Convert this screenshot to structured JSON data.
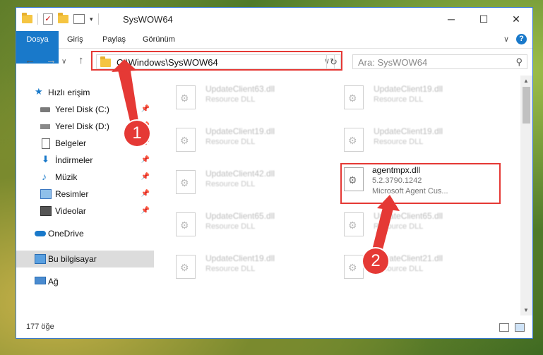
{
  "window": {
    "title": "SysWOW64",
    "minimize": "─",
    "maximize": "☐",
    "close": "✕"
  },
  "ribbon": {
    "tabs": [
      "Dosya",
      "Giriş",
      "Paylaş",
      "Görünüm"
    ],
    "help": "?",
    "expand": "∨"
  },
  "nav": {
    "back": "←",
    "forward": "→",
    "up": "↑",
    "address": "C:\\Windows\\SysWOW64",
    "dropdown": "∨",
    "refresh": "↻",
    "search_placeholder": "Ara: SysWOW64",
    "search_icon": "⚲"
  },
  "sidebar": {
    "items": [
      {
        "label": "Hızlı erişim",
        "icon": "star-icon",
        "pinned": false
      },
      {
        "label": "Yerel Disk (C:)",
        "icon": "disk-icon",
        "pinned": true
      },
      {
        "label": "Yerel Disk (D:)",
        "icon": "disk-icon",
        "pinned": true
      },
      {
        "label": "Belgeler",
        "icon": "document-icon",
        "pinned": true
      },
      {
        "label": "İndirmeler",
        "icon": "download-icon",
        "pinned": true
      },
      {
        "label": "Müzik",
        "icon": "music-icon",
        "pinned": true
      },
      {
        "label": "Resimler",
        "icon": "pictures-icon",
        "pinned": true
      },
      {
        "label": "Videolar",
        "icon": "video-icon",
        "pinned": true
      },
      {
        "label": "OneDrive",
        "icon": "cloud-icon",
        "pinned": false
      },
      {
        "label": "Bu bilgisayar",
        "icon": "pc-icon",
        "pinned": false,
        "selected": true
      },
      {
        "label": "Ağ",
        "icon": "network-icon",
        "pinned": false
      }
    ],
    "pin_glyph": "📌"
  },
  "files": [
    {
      "name": "UpdateClient63.dll",
      "desc": "Resource DLL",
      "blurred": true
    },
    {
      "name": "UpdateClient19.dll",
      "desc": "Resource DLL",
      "blurred": true
    },
    {
      "name": "UpdateClient19.dll",
      "desc": "Resource DLL",
      "blurred": true
    },
    {
      "name": "UpdateClient19.dll",
      "desc": "Resource DLL",
      "blurred": true
    },
    {
      "name": "UpdateClient42.dll",
      "desc": "Resource DLL",
      "blurred": true
    },
    {
      "name": "agentmpx.dll",
      "desc": "5.2.3790.1242",
      "desc2": "Microsoft Agent Cus...",
      "blurred": false
    },
    {
      "name": "UpdateClient65.dll",
      "desc": "Resource DLL",
      "blurred": true
    },
    {
      "name": "UpdateClient65.dll",
      "desc": "Resource DLL",
      "blurred": true
    },
    {
      "name": "UpdateClient19.dll",
      "desc": "Resource DLL",
      "blurred": true
    },
    {
      "name": "UpdateClient21.dll",
      "desc": "Resource DLL",
      "blurred": true
    }
  ],
  "status": {
    "count": "177 öğe"
  },
  "callouts": [
    "1",
    "2"
  ],
  "colors": {
    "accent": "#1979ca",
    "highlight": "#e53935"
  }
}
